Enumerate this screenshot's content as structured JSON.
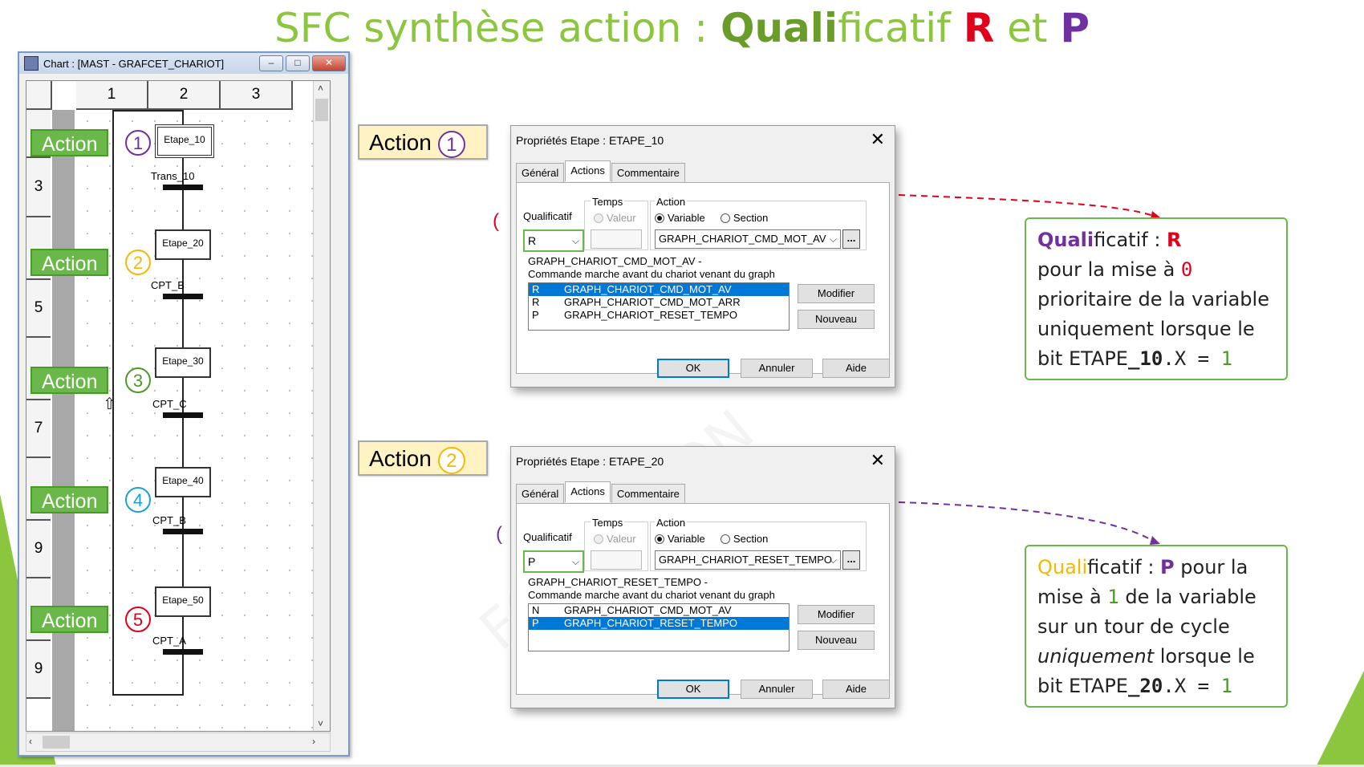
{
  "title": {
    "part1": "SFC synthèse ",
    "part2": "action",
    "part3": " : ",
    "part4": "Quali",
    "part5": "ficatif ",
    "letter_r": "R",
    "part6": " et ",
    "letter_p": "P"
  },
  "chart_window": {
    "title": "Chart : [MAST - GRAFCET_CHARIOT]",
    "btn_min": "–",
    "btn_max": "□",
    "btn_close": "✕",
    "columns": [
      "1",
      "2",
      "3"
    ],
    "rows": [
      "3",
      "5",
      "7",
      "9",
      "9"
    ],
    "steps": [
      "Etape_10",
      "Etape_20",
      "Etape_30",
      "Etape_40",
      "Etape_50"
    ],
    "transitions": [
      "Trans_10",
      "CPT_B",
      "CPT_C",
      "CPT_B",
      "CPT_A"
    ],
    "actions": [
      {
        "label": "Action",
        "num": "1",
        "color": "#7030a0"
      },
      {
        "label": "Action",
        "num": "2",
        "color": "#f5b800"
      },
      {
        "label": "Action",
        "num": "3",
        "color": "#4a9a2a"
      },
      {
        "label": "Action",
        "num": "4",
        "color": "#1aa0d8"
      },
      {
        "label": "Action",
        "num": "5",
        "color": "#e0001a"
      }
    ]
  },
  "side_labels": [
    {
      "label": "Action",
      "num": "1",
      "color": "#7030a0"
    },
    {
      "label": "Action",
      "num": "2",
      "color": "#f5b800"
    }
  ],
  "dialog1": {
    "title": "Propriétés Etape : ETAPE_10",
    "tabs": [
      "Général",
      "Actions",
      "Commentaire"
    ],
    "qualificatif_label": "Qualificatif",
    "qualificatif_value": "R",
    "temps_label": "Temps",
    "valeur_label": "Valeur",
    "action_label": "Action",
    "variable_label": "Variable",
    "section_label": "Section",
    "variable_value": "GRAPH_CHARIOT_CMD_MOT_AV",
    "dots": "...",
    "desc_line1": "GRAPH_CHARIOT_CMD_MOT_AV -",
    "desc_line2": "Commande marche avant du chariot venant du graph",
    "list": [
      {
        "q": "R",
        "name": "GRAPH_CHARIOT_CMD_MOT_AV",
        "selected": true
      },
      {
        "q": "R",
        "name": "GRAPH_CHARIOT_CMD_MOT_ARR",
        "selected": false
      },
      {
        "q": "P",
        "name": "GRAPH_CHARIOT_RESET_TEMPO",
        "selected": false
      }
    ],
    "modifier": "Modifier",
    "nouveau": "Nouveau",
    "ok": "OK",
    "annuler": "Annuler",
    "aide": "Aide"
  },
  "dialog2": {
    "title": "Propriétés Etape : ETAPE_20",
    "tabs": [
      "Général",
      "Actions",
      "Commentaire"
    ],
    "qualificatif_label": "Qualificatif",
    "qualificatif_value": "P",
    "temps_label": "Temps",
    "valeur_label": "Valeur",
    "action_label": "Action",
    "variable_label": "Variable",
    "section_label": "Section",
    "variable_value": "GRAPH_CHARIOT_RESET_TEMPO",
    "dots": "...",
    "desc_line1": "GRAPH_CHARIOT_RESET_TEMPO -",
    "desc_line2": "Commande marche avant du chariot venant du graph",
    "list": [
      {
        "q": "N",
        "name": "GRAPH_CHARIOT_CMD_MOT_AV",
        "selected": false
      },
      {
        "q": "P",
        "name": "GRAPH_CHARIOT_RESET_TEMPO",
        "selected": true
      }
    ],
    "modifier": "Modifier",
    "nouveau": "Nouveau",
    "ok": "OK",
    "annuler": "Annuler",
    "aide": "Aide"
  },
  "callout1": {
    "w1": "Quali",
    "w2": "ficatif : ",
    "letter": "R",
    "l2": "pour la mise à ",
    "zero": "0",
    "l3": "prioritaire de la variable",
    "l4": "uniquement lorsque le",
    "l5a": "bit ETAPE",
    "l5b": "_10",
    "l5c": ".X  =  ",
    "one": "1"
  },
  "callout2": {
    "w1": "Quali",
    "w2": "ficatif : ",
    "letter": "P",
    "l1b": " pour la",
    "l2a": "mise à ",
    "one_a": "1",
    "l2b": " de la variable",
    "l3": "sur un tour de cycle",
    "l4a": "uniquement",
    "l4b": " lorsque le",
    "l5a": "bit ETAPE",
    "l5b": "_20",
    "l5c": ".X  =  ",
    "one": "1"
  },
  "colors": {
    "green": "#8cc63f",
    "red": "#e0001a",
    "purple": "#7030a0",
    "gold": "#f5b800",
    "select_blue": "#0078d7"
  }
}
